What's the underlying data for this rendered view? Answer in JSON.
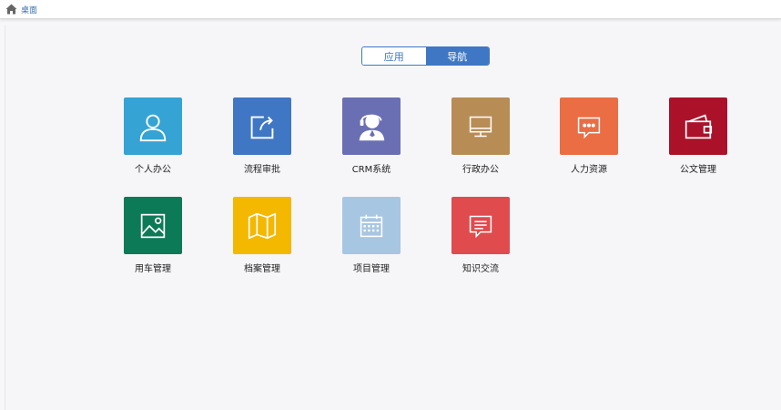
{
  "header": {
    "home_label": "桌面",
    "home_icon": "home-icon"
  },
  "switcher": {
    "options": [
      "应用",
      "导航"
    ],
    "selected": "导航",
    "accent": "#3f77c4"
  },
  "apps": [
    {
      "label": "个人办公",
      "icon": "person-icon",
      "color": "#35a3d4"
    },
    {
      "label": "流程审批",
      "icon": "share-arrow-icon",
      "color": "#3f77c4"
    },
    {
      "label": "CRM系统",
      "icon": "customer-service-icon",
      "color": "#6a6fb4"
    },
    {
      "label": "行政办公",
      "icon": "monitor-icon",
      "color": "#b88c55"
    },
    {
      "label": "人力资源",
      "icon": "chat-bubble-icon",
      "color": "#ea6d44"
    },
    {
      "label": "公文管理",
      "icon": "wallet-icon",
      "color": "#ab1229"
    },
    {
      "label": "用车管理",
      "icon": "picture-icon",
      "color": "#0d7a57"
    },
    {
      "label": "档案管理",
      "icon": "map-icon",
      "color": "#f4b800"
    },
    {
      "label": "项目管理",
      "icon": "calendar-icon",
      "color": "#a7c6e1"
    },
    {
      "label": "知识交流",
      "icon": "message-icon",
      "color": "#e04b4d"
    }
  ]
}
